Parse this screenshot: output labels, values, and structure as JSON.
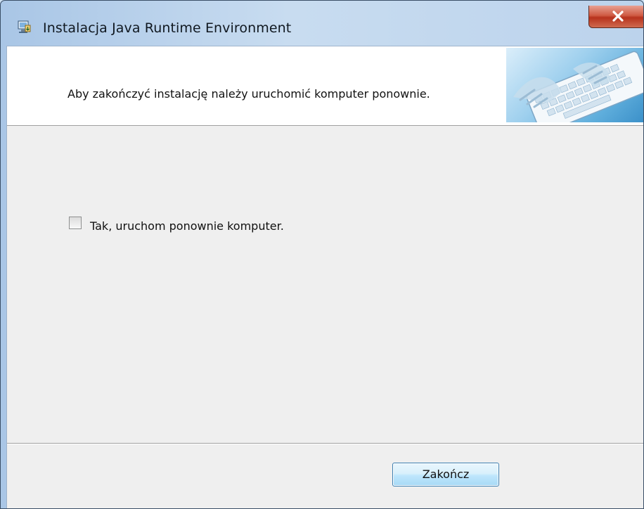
{
  "window": {
    "title": "Instalacja Java Runtime Environment",
    "app_icon": "installer-icon",
    "close_icon": "close-icon",
    "close_color": "#c74a33"
  },
  "banner": {
    "message": "Aby zakończyć instalację należy uruchomić komputer ponownie.",
    "image": "keyboard-image"
  },
  "options": {
    "restart_label": "Tak, uruchom ponownie komputer.",
    "restart_checked": false
  },
  "footer": {
    "finish_label": "Zakończ"
  }
}
